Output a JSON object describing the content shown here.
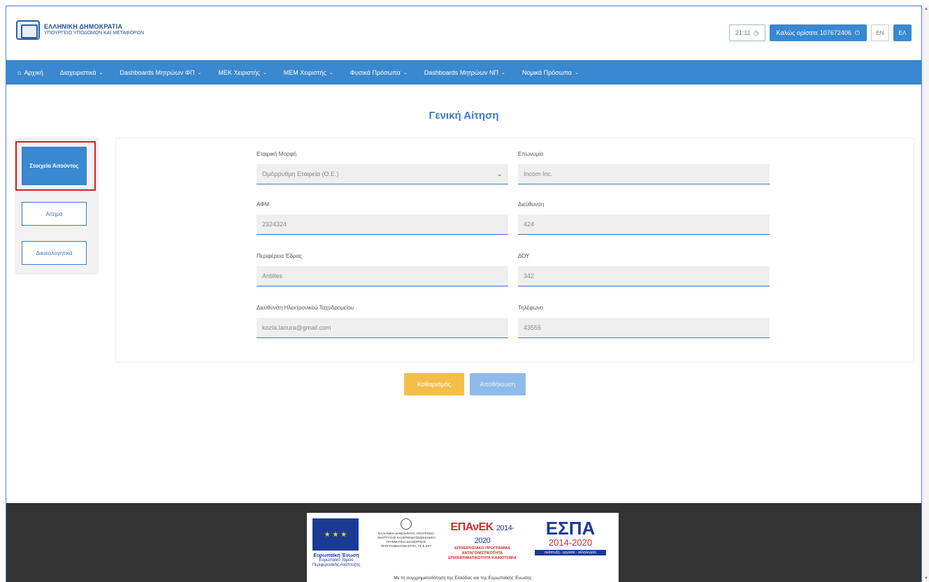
{
  "header": {
    "org_title": "ΕΛΛΗΝΙΚΗ ΔΗΜΟΚΡΑΤΙΑ",
    "org_subtitle": "ΥΠΟΥΡΓΕΙΟ ΥΠΟΔΟΜΩΝ ΚΑΙ ΜΕΤΑΦΟΡΩΝ",
    "clock": "21:11",
    "welcome": "Καλώς ορίσατε 107672406",
    "lang_en": "EN",
    "lang_el": "ΕΛ"
  },
  "nav": {
    "items": [
      {
        "label": "Αρχική",
        "icon": "home-icon"
      },
      {
        "label": "Διαχειριστικά"
      },
      {
        "label": "Dashboards Μητρώων ΦΠ"
      },
      {
        "label": "ΜΕΚ Χειριστής"
      },
      {
        "label": "ΜΕΜ Χειριστής"
      },
      {
        "label": "Φυσικά Πρόσωπα"
      },
      {
        "label": "Dashboards Μητρώων ΝΠ"
      },
      {
        "label": "Νομικά Πρόσωπα"
      }
    ]
  },
  "page": {
    "title": "Γενική Αίτηση"
  },
  "side_tabs": {
    "applicant": "Στοιχεία Αιτούντος",
    "request": "Αίτημα",
    "documents": "Δικαιολογητικά"
  },
  "form": {
    "company_type": {
      "label": "Εταιρική Μορφή",
      "value": "Ομόρρυθμη Εταιρεία (Ο.Ε.)"
    },
    "name": {
      "label": "Επωνυμία",
      "value": "Incom Inc."
    },
    "afm": {
      "label": "ΑΦΜ",
      "value": "2324324"
    },
    "address": {
      "label": "Διεύθυνση",
      "value": "424"
    },
    "region": {
      "label": "Περιφέρεια Έδρας",
      "value": "Antilles"
    },
    "doy": {
      "label": "ΔΟΥ",
      "value": "342"
    },
    "email": {
      "label": "Διεύθυνση Ηλεκτρονικού Ταχυδρομείου",
      "value": "kozla.laoura@gmail.com"
    },
    "phone": {
      "label": "Τηλέφωνο",
      "value": "43555"
    }
  },
  "actions": {
    "clear": "Καθαρισμός",
    "save": "Αποθήκευση"
  },
  "footer": {
    "eu_label": "Ευρωπαϊκή Ένωση",
    "eu_fund": "Ευρωπαϊκό Ταμείο Περιφερειακής Ανάπτυξης",
    "gr_text": "ΕΛΛΗΝΙΚΗ ΔΗΜΟΚΡΑΤΙΑ ΥΠΟΥΡΓΕΙΟ ΑΝΑΠΤΥΞΗΣ ΚΑΙ ΕΠΕΝΔΥΣΕΩΝ ΕΙΔΙΚΗ ΓΡΑΜΜΑΤΕΙΑ ΔΙΑΧΕΙΡΙΣΗΣ ΠΡΟΓΡΑΜΜΑΤΩΝ ΕΤΠΑ, ΤΣ & ΕΚΤ",
    "epanek_title": "ΕΠΑνΕΚ",
    "epanek_years": "2014-2020",
    "epanek_text": "ΕΠΙΧΕΙΡΗΣΙΑΚΟ ΠΡΟΓΡΑΜΜΑ ΑΝΤΑΓΩΝΙΣΤΙΚΟΤΗΤΑ ΕΠΙΧΕΙΡΗΜΑΤΙΚΟΤΗΤΑ ΚΑΙΝΟΤΟΜΙΑ",
    "espa_title": "ΕΣΠΑ",
    "espa_years": "2014-2020",
    "espa_tag": "ανάπτυξη - εργασία - αλληλεγγύη",
    "cofund": "Με τη συγχρηματοδότηση της Ελλάδας και της Ευρωπαϊκής Ένωσης"
  },
  "colors": {
    "primary": "#3a88cf",
    "title_blue": "#3a7bc6",
    "clear_button": "#f3bf4a",
    "save_button_disabled": "#8fbbea",
    "highlight": "#e01b24",
    "footer_bg": "#333333"
  }
}
